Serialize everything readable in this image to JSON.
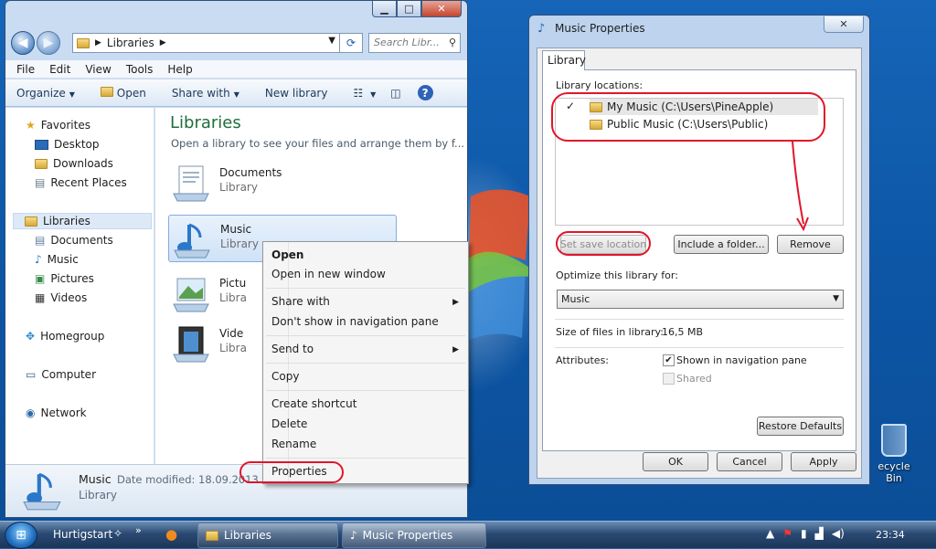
{
  "explorer": {
    "address": {
      "crumb": "Libraries"
    },
    "search_placeholder": "Search Libr...",
    "menu": [
      "File",
      "Edit",
      "View",
      "Tools",
      "Help"
    ],
    "toolbar": {
      "organize": "Organize",
      "open": "Open",
      "share_with": "Share with",
      "new_library": "New library"
    },
    "nav": {
      "favorites": "Favorites",
      "desktop": "Desktop",
      "downloads": "Downloads",
      "recent_places": "Recent Places",
      "libraries": "Libraries",
      "documents": "Documents",
      "music": "Music",
      "pictures": "Pictures",
      "videos": "Videos",
      "homegroup": "Homegroup",
      "computer": "Computer",
      "network": "Network"
    },
    "content": {
      "title": "Libraries",
      "subtitle": "Open a library to see your files and arrange them by f...",
      "items": [
        {
          "name": "Documents",
          "kind": "Library"
        },
        {
          "name": "Music",
          "kind": "Library"
        },
        {
          "name": "Pictu",
          "kind": "Libra"
        },
        {
          "name": "Vide",
          "kind": "Libra"
        }
      ]
    },
    "details": {
      "name": "Music",
      "modified": "Date modified: 18.09.2013",
      "kind": "Library"
    }
  },
  "context_menu": {
    "open": "Open",
    "open_new_window": "Open in new window",
    "share_with": "Share with",
    "dont_show": "Don't show in navigation pane",
    "send_to": "Send to",
    "copy": "Copy",
    "create_shortcut": "Create shortcut",
    "delete": "Delete",
    "rename": "Rename",
    "properties": "Properties"
  },
  "properties": {
    "title": "Music Properties",
    "tab": "Library",
    "locations_label": "Library locations:",
    "locations": [
      {
        "name": "My Music (C:\\Users\\PineApple)",
        "check": "✓"
      },
      {
        "name": "Public Music (C:\\Users\\Public)"
      }
    ],
    "set_save_location": "Set save location",
    "include_folder": "Include a folder...",
    "remove": "Remove",
    "optimize_label": "Optimize this library for:",
    "optimize_value": "Music",
    "size_label": "Size of files in library:",
    "size_value": "16,5 MB",
    "attributes_label": "Attributes:",
    "shown_nav": "Shown in navigation pane",
    "shared": "Shared",
    "restore_defaults": "Restore Defaults",
    "ok": "OK",
    "cancel": "Cancel",
    "apply": "Apply"
  },
  "desktop": {
    "recycle_bin": "ecycle Bin"
  },
  "taskbar": {
    "quicklaunch_label": "Hurtigstart",
    "chevron": "»",
    "libraries": "Libraries",
    "music_properties": "Music Properties",
    "clock": "23:34"
  },
  "colors": {
    "accent": "#1e6e3c",
    "annotation": "#e0162b",
    "desktop": "#0d57a7"
  }
}
